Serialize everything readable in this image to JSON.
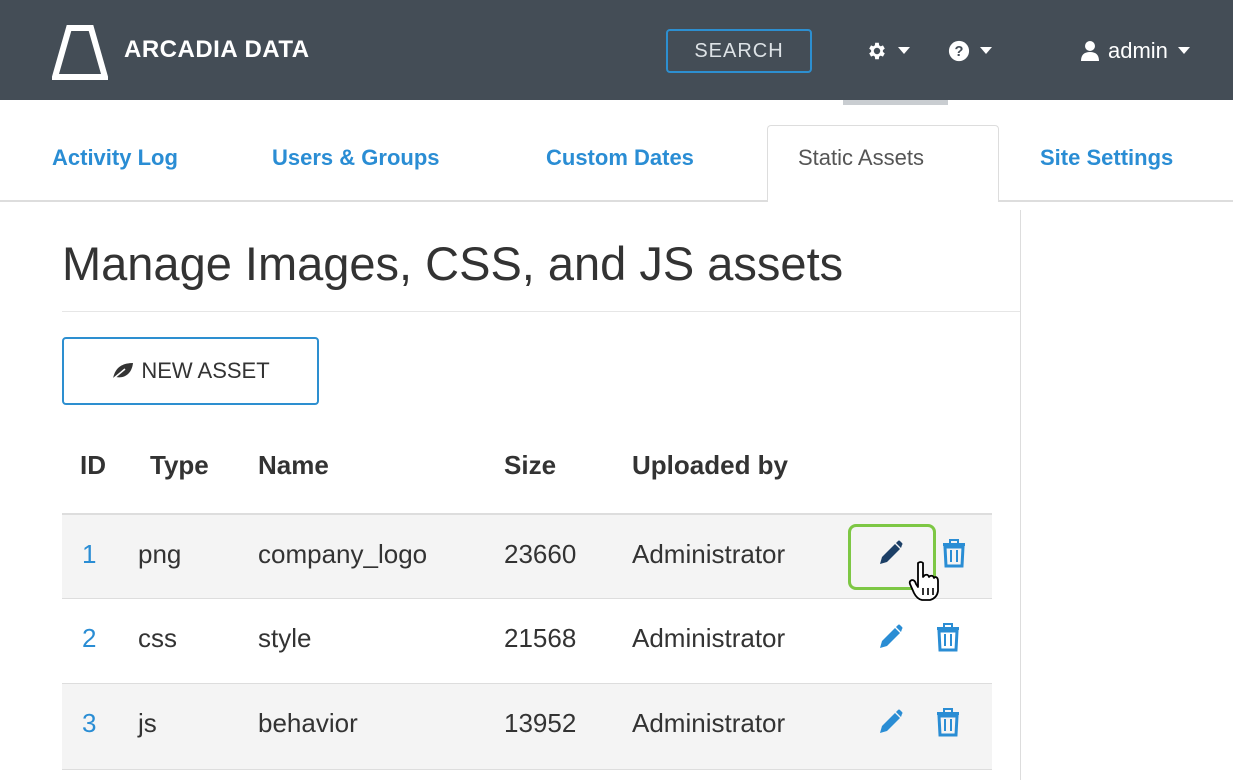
{
  "brand": {
    "name": "ARCADIA DATA"
  },
  "navbar": {
    "search_label": "SEARCH",
    "settings_icon": "gear-icon",
    "help_icon": "question-circle-icon",
    "user_icon": "user-icon",
    "user_label": "admin"
  },
  "tabs": [
    {
      "label": "Activity Log",
      "active": false
    },
    {
      "label": "Users & Groups",
      "active": false
    },
    {
      "label": "Custom Dates",
      "active": false
    },
    {
      "label": "Static Assets",
      "active": true
    },
    {
      "label": "Site Settings",
      "active": false
    }
  ],
  "page": {
    "title": "Manage Images, CSS, and JS assets",
    "new_asset_label": "NEW ASSET"
  },
  "table": {
    "headers": [
      "ID",
      "Type",
      "Name",
      "Size",
      "Uploaded by"
    ],
    "rows": [
      {
        "id": "1",
        "type": "png",
        "name": "company_logo",
        "size": "23660",
        "uploaded_by": "Administrator"
      },
      {
        "id": "2",
        "type": "css",
        "name": "style",
        "size": "21568",
        "uploaded_by": "Administrator"
      },
      {
        "id": "3",
        "type": "js",
        "name": "behavior",
        "size": "13952",
        "uploaded_by": "Administrator"
      }
    ],
    "edit_icon": "pencil-icon",
    "delete_icon": "trash-icon"
  },
  "colors": {
    "navbar_bg": "#444d56",
    "accent_blue": "#2a8dd4",
    "focus_green": "#7dc744",
    "row_stripe": "#f4f4f4"
  }
}
